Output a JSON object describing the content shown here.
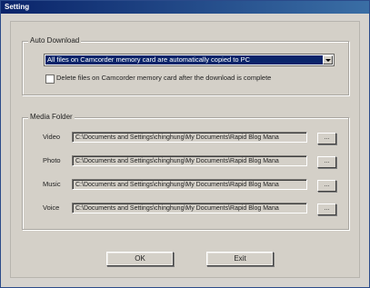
{
  "window": {
    "title": "Setting"
  },
  "auto_download": {
    "group_title": "Auto Download",
    "selected_option": "All files on Camcorder memory card are automatically copied to PC",
    "delete_checkbox_label": "Delete files on Camcorder memory card after the download is complete",
    "delete_checked": false
  },
  "media_folder": {
    "group_title": "Media Folder",
    "rows": [
      {
        "label": "Video",
        "path": "C:\\Documents and Settings\\chinghung\\My Documents\\Rapid Blog Mana",
        "browse_label": "..."
      },
      {
        "label": "Photo",
        "path": "C:\\Documents and Settings\\chinghung\\My Documents\\Rapid Blog Mana",
        "browse_label": "..."
      },
      {
        "label": "Music",
        "path": "C:\\Documents and Settings\\chinghung\\My Documents\\Rapid Blog Mana",
        "browse_label": "..."
      },
      {
        "label": "Voice",
        "path": "C:\\Documents and Settings\\chinghung\\My Documents\\Rapid Blog Mana",
        "browse_label": "..."
      }
    ]
  },
  "buttons": {
    "ok": "OK",
    "exit": "Exit"
  },
  "colors": {
    "titlebar": "#0a246a",
    "selection": "#0a246a",
    "dialog_bg": "#d4d0c8"
  }
}
